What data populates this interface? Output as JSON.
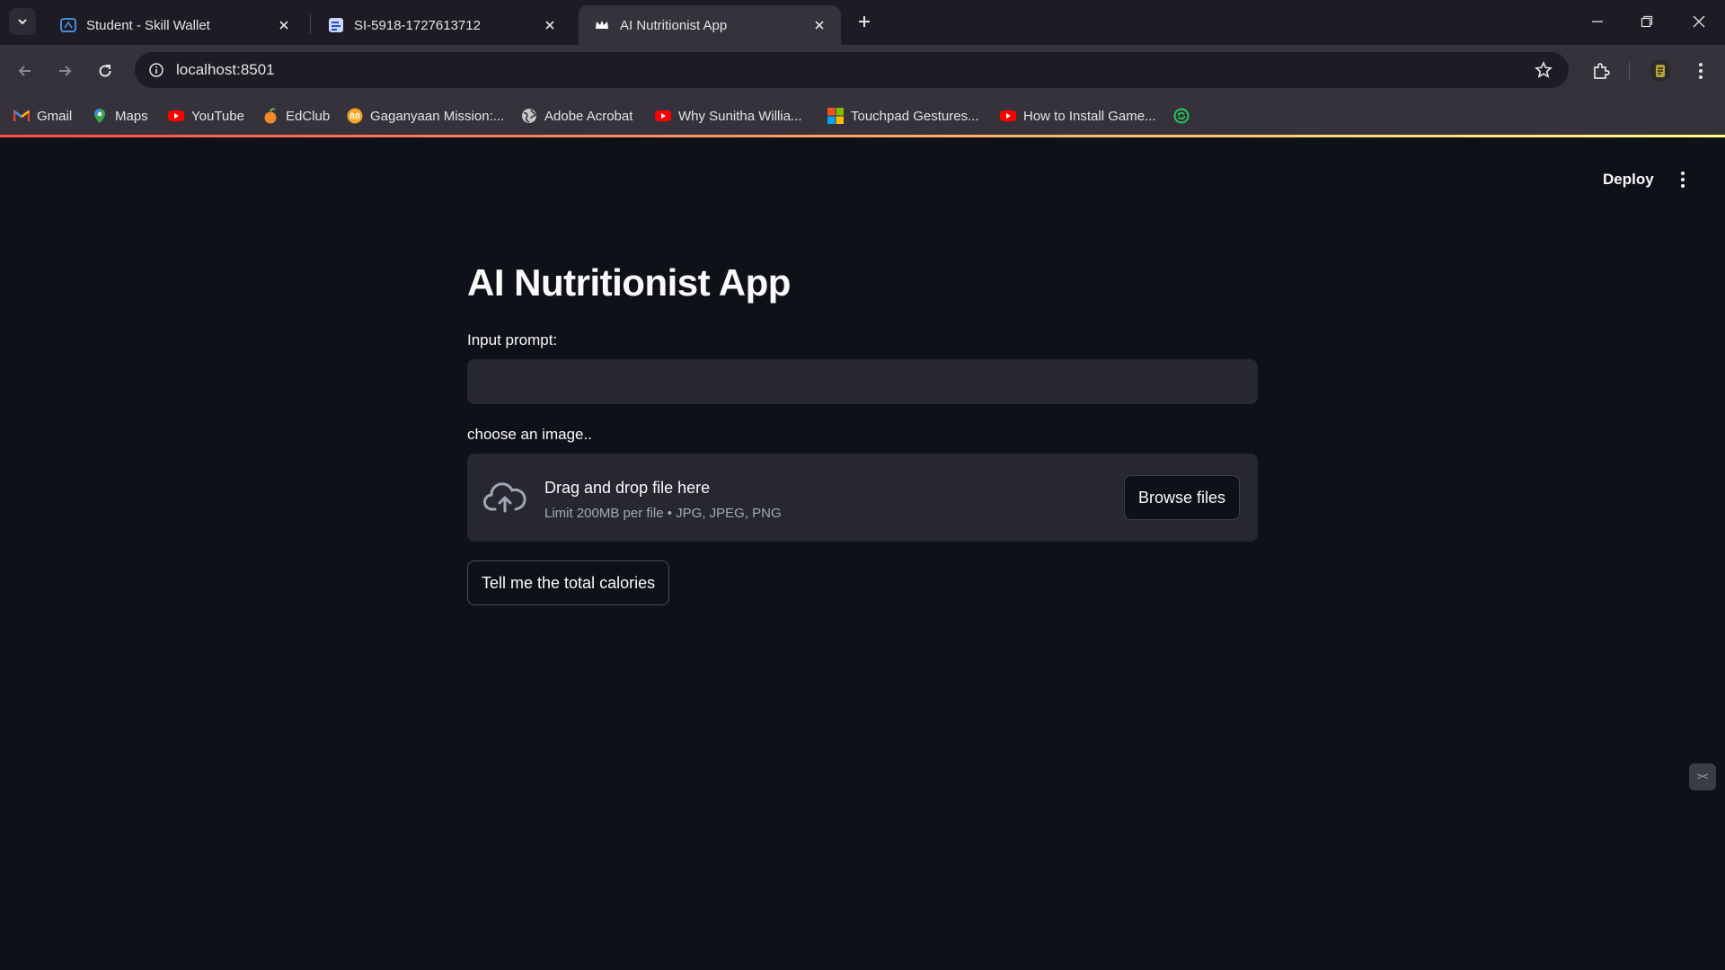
{
  "browser": {
    "tabs": [
      {
        "title": "Student - Skill Wallet",
        "icon": "skill-wallet-icon",
        "active": false
      },
      {
        "title": "SI-5918-1727613712",
        "icon": "document-icon",
        "active": false
      },
      {
        "title": "AI Nutritionist App",
        "icon": "streamlit-crown-icon",
        "active": true
      }
    ],
    "url": "localhost:8501",
    "bookmarks": [
      {
        "label": "Gmail",
        "icon": "gmail-icon"
      },
      {
        "label": "Maps",
        "icon": "maps-icon"
      },
      {
        "label": "YouTube",
        "icon": "youtube-icon"
      },
      {
        "label": "EdClub",
        "icon": "edclub-icon"
      },
      {
        "label": "Gaganyaan Mission:...",
        "icon": "gaganyaan-icon"
      },
      {
        "label": "Adobe Acrobat",
        "icon": "globe-icon"
      },
      {
        "label": "Why Sunitha Willia...",
        "icon": "youtube-icon"
      },
      {
        "label": "Touchpad Gestures...",
        "icon": "microsoft-icon"
      },
      {
        "label": "How to Install Game...",
        "icon": "youtube-icon"
      }
    ]
  },
  "app": {
    "deploy_label": "Deploy",
    "title": "AI Nutritionist App",
    "input_label": "Input prompt:",
    "input_value": "",
    "uploader_label": "choose an image..",
    "dropzone_title": "Drag and drop file here",
    "dropzone_limit": "Limit 200MB per file • JPG, JPEG, PNG",
    "browse_label": "Browse files",
    "submit_label": "Tell me the total calories"
  },
  "colors": {
    "accent_gradient_start": "#ff4b4b",
    "accent_gradient_end": "#fffd80",
    "background": "#0e1117",
    "secondary_background": "#262730"
  }
}
